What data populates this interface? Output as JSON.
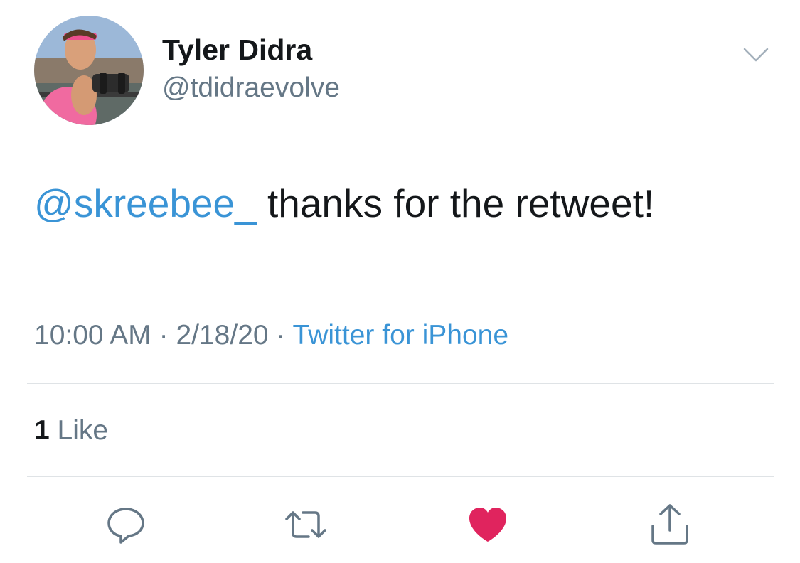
{
  "tweet": {
    "author": {
      "display_name": "Tyler Didra",
      "handle": "@tdidraevolve"
    },
    "body": {
      "mention": "@skreebee_",
      "text": " thanks for the retweet!"
    },
    "meta": {
      "time": "10:00 AM",
      "separator": " · ",
      "date": "2/18/20",
      "source": "Twitter for iPhone"
    },
    "stats": {
      "like_count": "1",
      "like_label": " Like"
    },
    "actions": [
      {
        "name": "reply",
        "icon": "reply-icon"
      },
      {
        "name": "retweet",
        "icon": "retweet-icon"
      },
      {
        "name": "like",
        "icon": "heart-icon",
        "active": true
      },
      {
        "name": "share",
        "icon": "share-icon"
      }
    ]
  },
  "colors": {
    "link": "#3a94d6",
    "text": "#14171a",
    "secondary": "#657786",
    "like_active": "#e0245e",
    "divider": "#dfe3e6"
  }
}
